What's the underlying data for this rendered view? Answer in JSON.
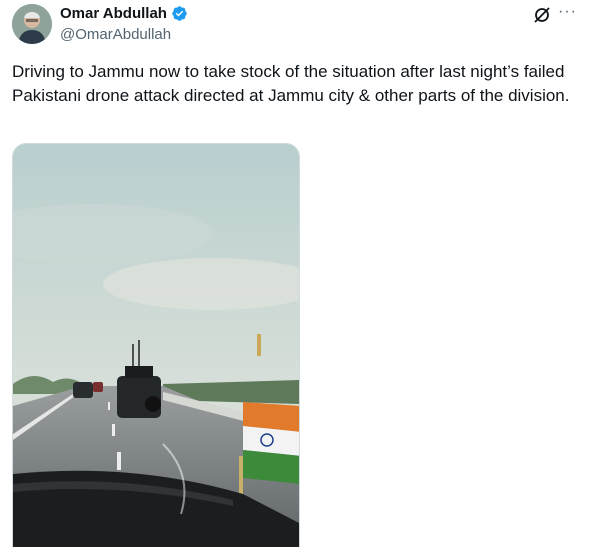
{
  "author": {
    "name": "Omar Abdullah",
    "handle": "@OmarAbdullah",
    "verified": true
  },
  "tweet": {
    "text": "Driving to Jammu now to take stock of the situation after last night’s failed Pakistani drone attack directed at Jammu city & other parts of the division."
  },
  "icons": {
    "verified": "verified-badge-icon",
    "grok": "grok-icon",
    "more": "more-options-icon"
  },
  "colors": {
    "verified_blue": "#1d9bf0",
    "secondary_text": "#536471"
  }
}
